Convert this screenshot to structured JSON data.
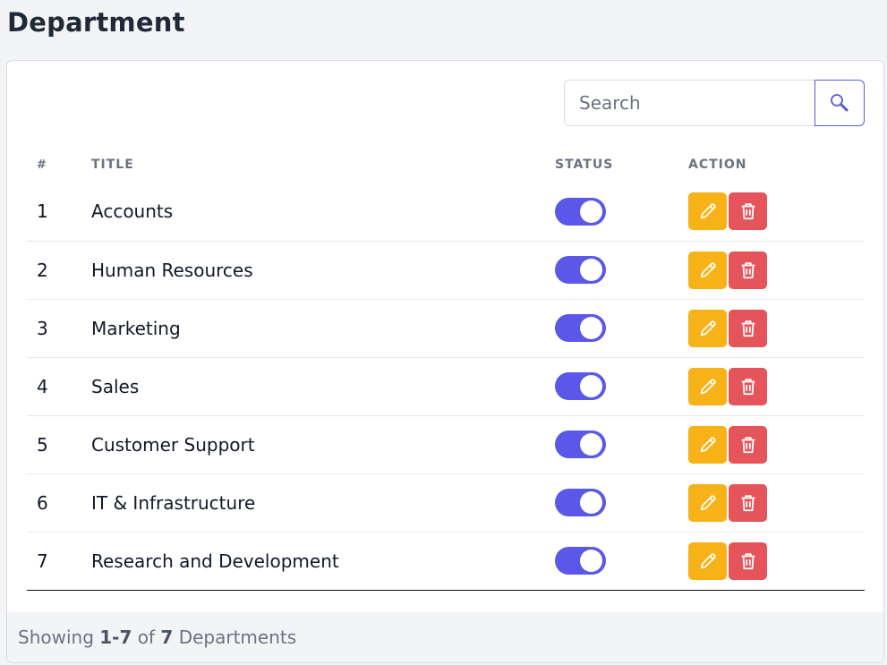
{
  "page": {
    "title": "Department"
  },
  "search": {
    "placeholder": "Search",
    "value": ""
  },
  "table": {
    "headers": {
      "num": "#",
      "title": "TITLE",
      "status": "STATUS",
      "action": "ACTION"
    },
    "rows": [
      {
        "num": "1",
        "title": "Accounts",
        "active": true
      },
      {
        "num": "2",
        "title": "Human Resources",
        "active": true
      },
      {
        "num": "3",
        "title": "Marketing",
        "active": true
      },
      {
        "num": "4",
        "title": "Sales",
        "active": true
      },
      {
        "num": "5",
        "title": "Customer Support",
        "active": true
      },
      {
        "num": "6",
        "title": "IT & Infrastructure",
        "active": true
      },
      {
        "num": "7",
        "title": "Research and Development",
        "active": true
      }
    ]
  },
  "footer": {
    "prefix": "Showing",
    "range": "1-7",
    "of": "of",
    "total": "7",
    "suffix": "Departments"
  },
  "colors": {
    "accent": "#5b57e8",
    "edit": "#f7b217",
    "delete": "#e5545a"
  },
  "icons": {
    "search": "magnifier-icon",
    "edit": "pencil-icon",
    "delete": "trash-icon"
  }
}
